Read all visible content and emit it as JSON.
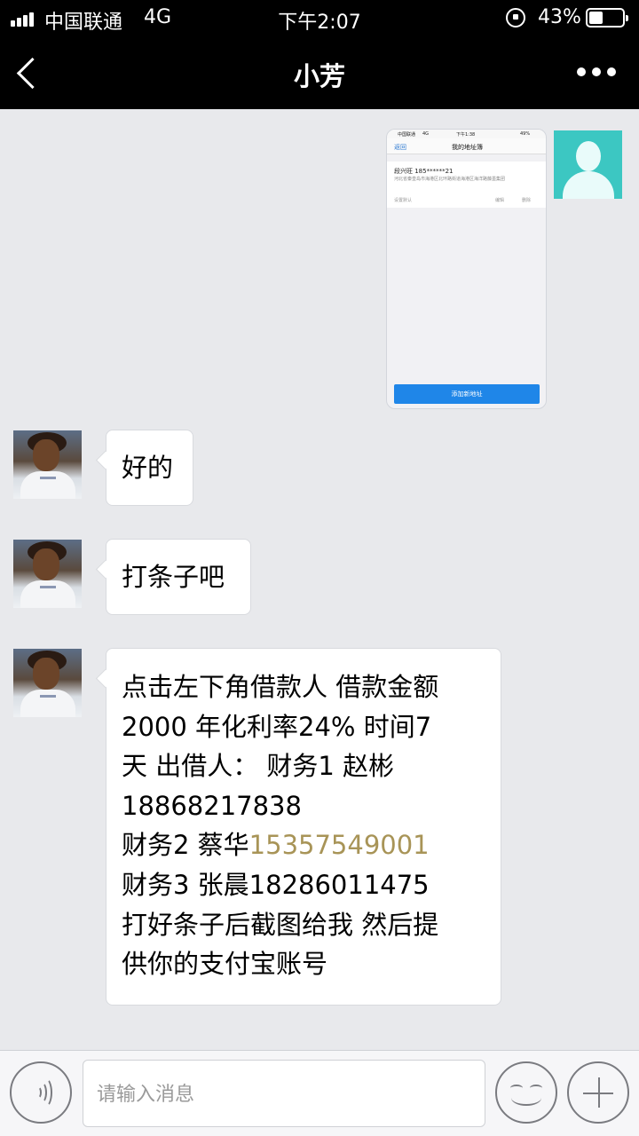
{
  "status_bar": {
    "carrier": "中国联通",
    "network": "4G",
    "time": "下午2:07",
    "battery_percent": "43%",
    "battery_level": 0.43
  },
  "nav": {
    "title": "小芳"
  },
  "messages": [
    {
      "sender": "self",
      "type": "image",
      "screenshot": {
        "carrier": "中国联通",
        "network": "4G",
        "time": "下午1:38",
        "battery": "49%",
        "back_label": "返回",
        "title": "我的地址簿",
        "name_phone": "段兴旺   185******21",
        "address": "河北省秦皇岛市海港区北环路街道海港区海洋路藤墨集团",
        "default_label": "设置默认",
        "edit_label": "编辑",
        "delete_label": "删除",
        "add_button": "添加新地址"
      }
    },
    {
      "sender": "other",
      "type": "text",
      "text": "好的"
    },
    {
      "sender": "other",
      "type": "text",
      "text": "打条子吧"
    },
    {
      "sender": "other",
      "type": "text",
      "lines": [
        "点击左下角借款人 借款金额",
        "2000 年化利率24%  时间7",
        "天 出借人：    财务1  赵彬",
        "18868217838",
        "财务2  蔡华",
        "15357549001",
        "财务3  张晨18286011475",
        "打好条子后截图给我 然后提",
        "供你的支付宝账号"
      ]
    }
  ],
  "footer": {
    "input_placeholder": "请输入消息"
  }
}
